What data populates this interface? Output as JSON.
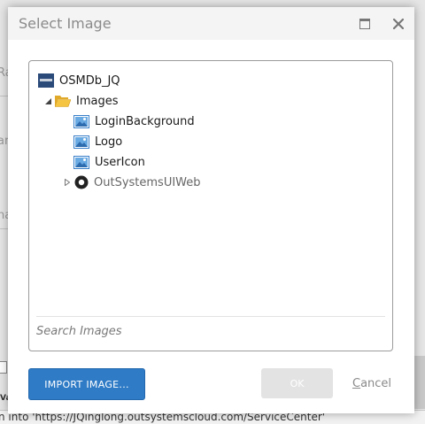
{
  "background": {
    "fragments": [
      "Ra",
      "ar",
      "na"
    ],
    "status_text": "n into 'https://JQinglong.outsystemscloud.com/ServiceCenter'",
    "column_header": "Va"
  },
  "dialog": {
    "title": "Select Image",
    "tree": [
      {
        "label": "OSMDb_JQ",
        "icon": "application-icon",
        "depth": 0,
        "expander": "none"
      },
      {
        "label": "Images",
        "icon": "folder-open-icon",
        "depth": 1,
        "expander": "expanded"
      },
      {
        "label": "LoginBackground",
        "icon": "image-icon",
        "depth": 2,
        "expander": "none"
      },
      {
        "label": "Logo",
        "icon": "image-icon",
        "depth": 2,
        "expander": "none"
      },
      {
        "label": "UserIcon",
        "icon": "image-icon",
        "depth": 2,
        "expander": "none"
      },
      {
        "label": "OutSystemsUIWeb",
        "icon": "module-icon",
        "depth": 1,
        "expander": "collapsed"
      }
    ],
    "search_placeholder": "Search Images",
    "import_label": "IMPORT IMAGE...",
    "ok_label": "OK",
    "cancel_label": "Cancel"
  },
  "colors": {
    "primary": "#2f7bc6",
    "folder": "#f5c542",
    "image": "#3a7fc9"
  }
}
